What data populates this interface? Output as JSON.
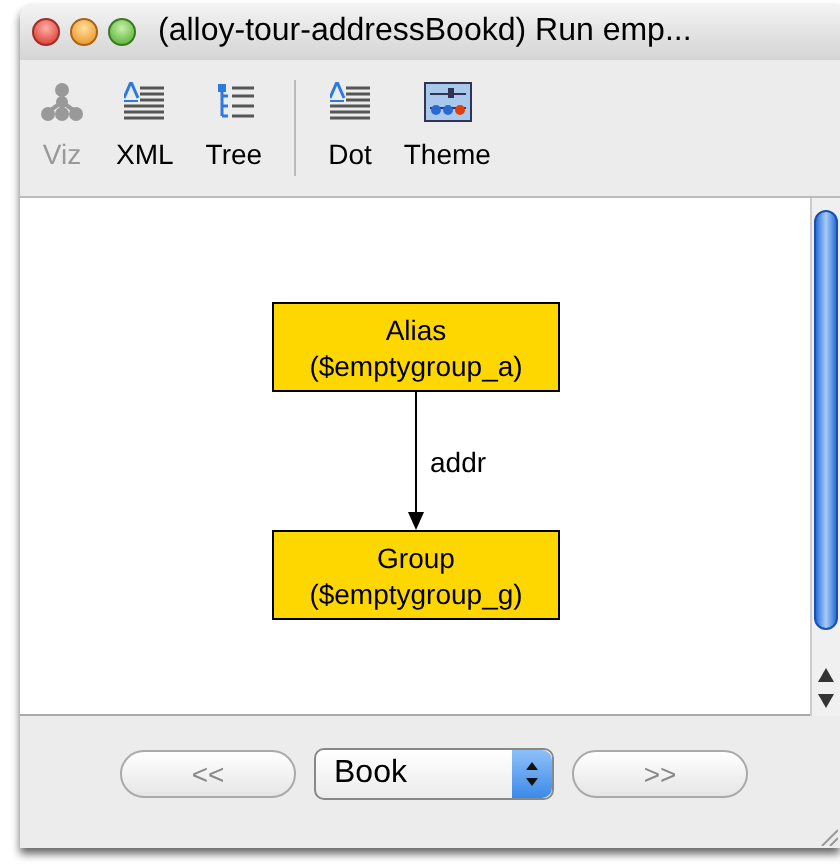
{
  "window": {
    "title": "(alloy-tour-addressBookd) Run emp..."
  },
  "toolbar_groups": [
    [
      {
        "label": "Viz",
        "kind": "viz",
        "disabled": true
      },
      {
        "label": "XML",
        "kind": "text",
        "disabled": false
      },
      {
        "label": "Tree",
        "kind": "tree",
        "disabled": false
      }
    ],
    [
      {
        "label": "Dot",
        "kind": "text",
        "disabled": false
      },
      {
        "label": "Theme",
        "kind": "theme",
        "disabled": false
      }
    ]
  ],
  "graph": {
    "nodes": [
      {
        "title": "Alias",
        "subtitle": "($emptygroup_a)"
      },
      {
        "title": "Group",
        "subtitle": "($emptygroup_g)"
      }
    ],
    "edges": [
      {
        "label": "addr"
      }
    ]
  },
  "navigation": {
    "previous": {
      "label": "<<",
      "disabled": true
    },
    "next": {
      "label": ">>",
      "disabled": true
    },
    "dropdown": {
      "value": "Book"
    }
  }
}
